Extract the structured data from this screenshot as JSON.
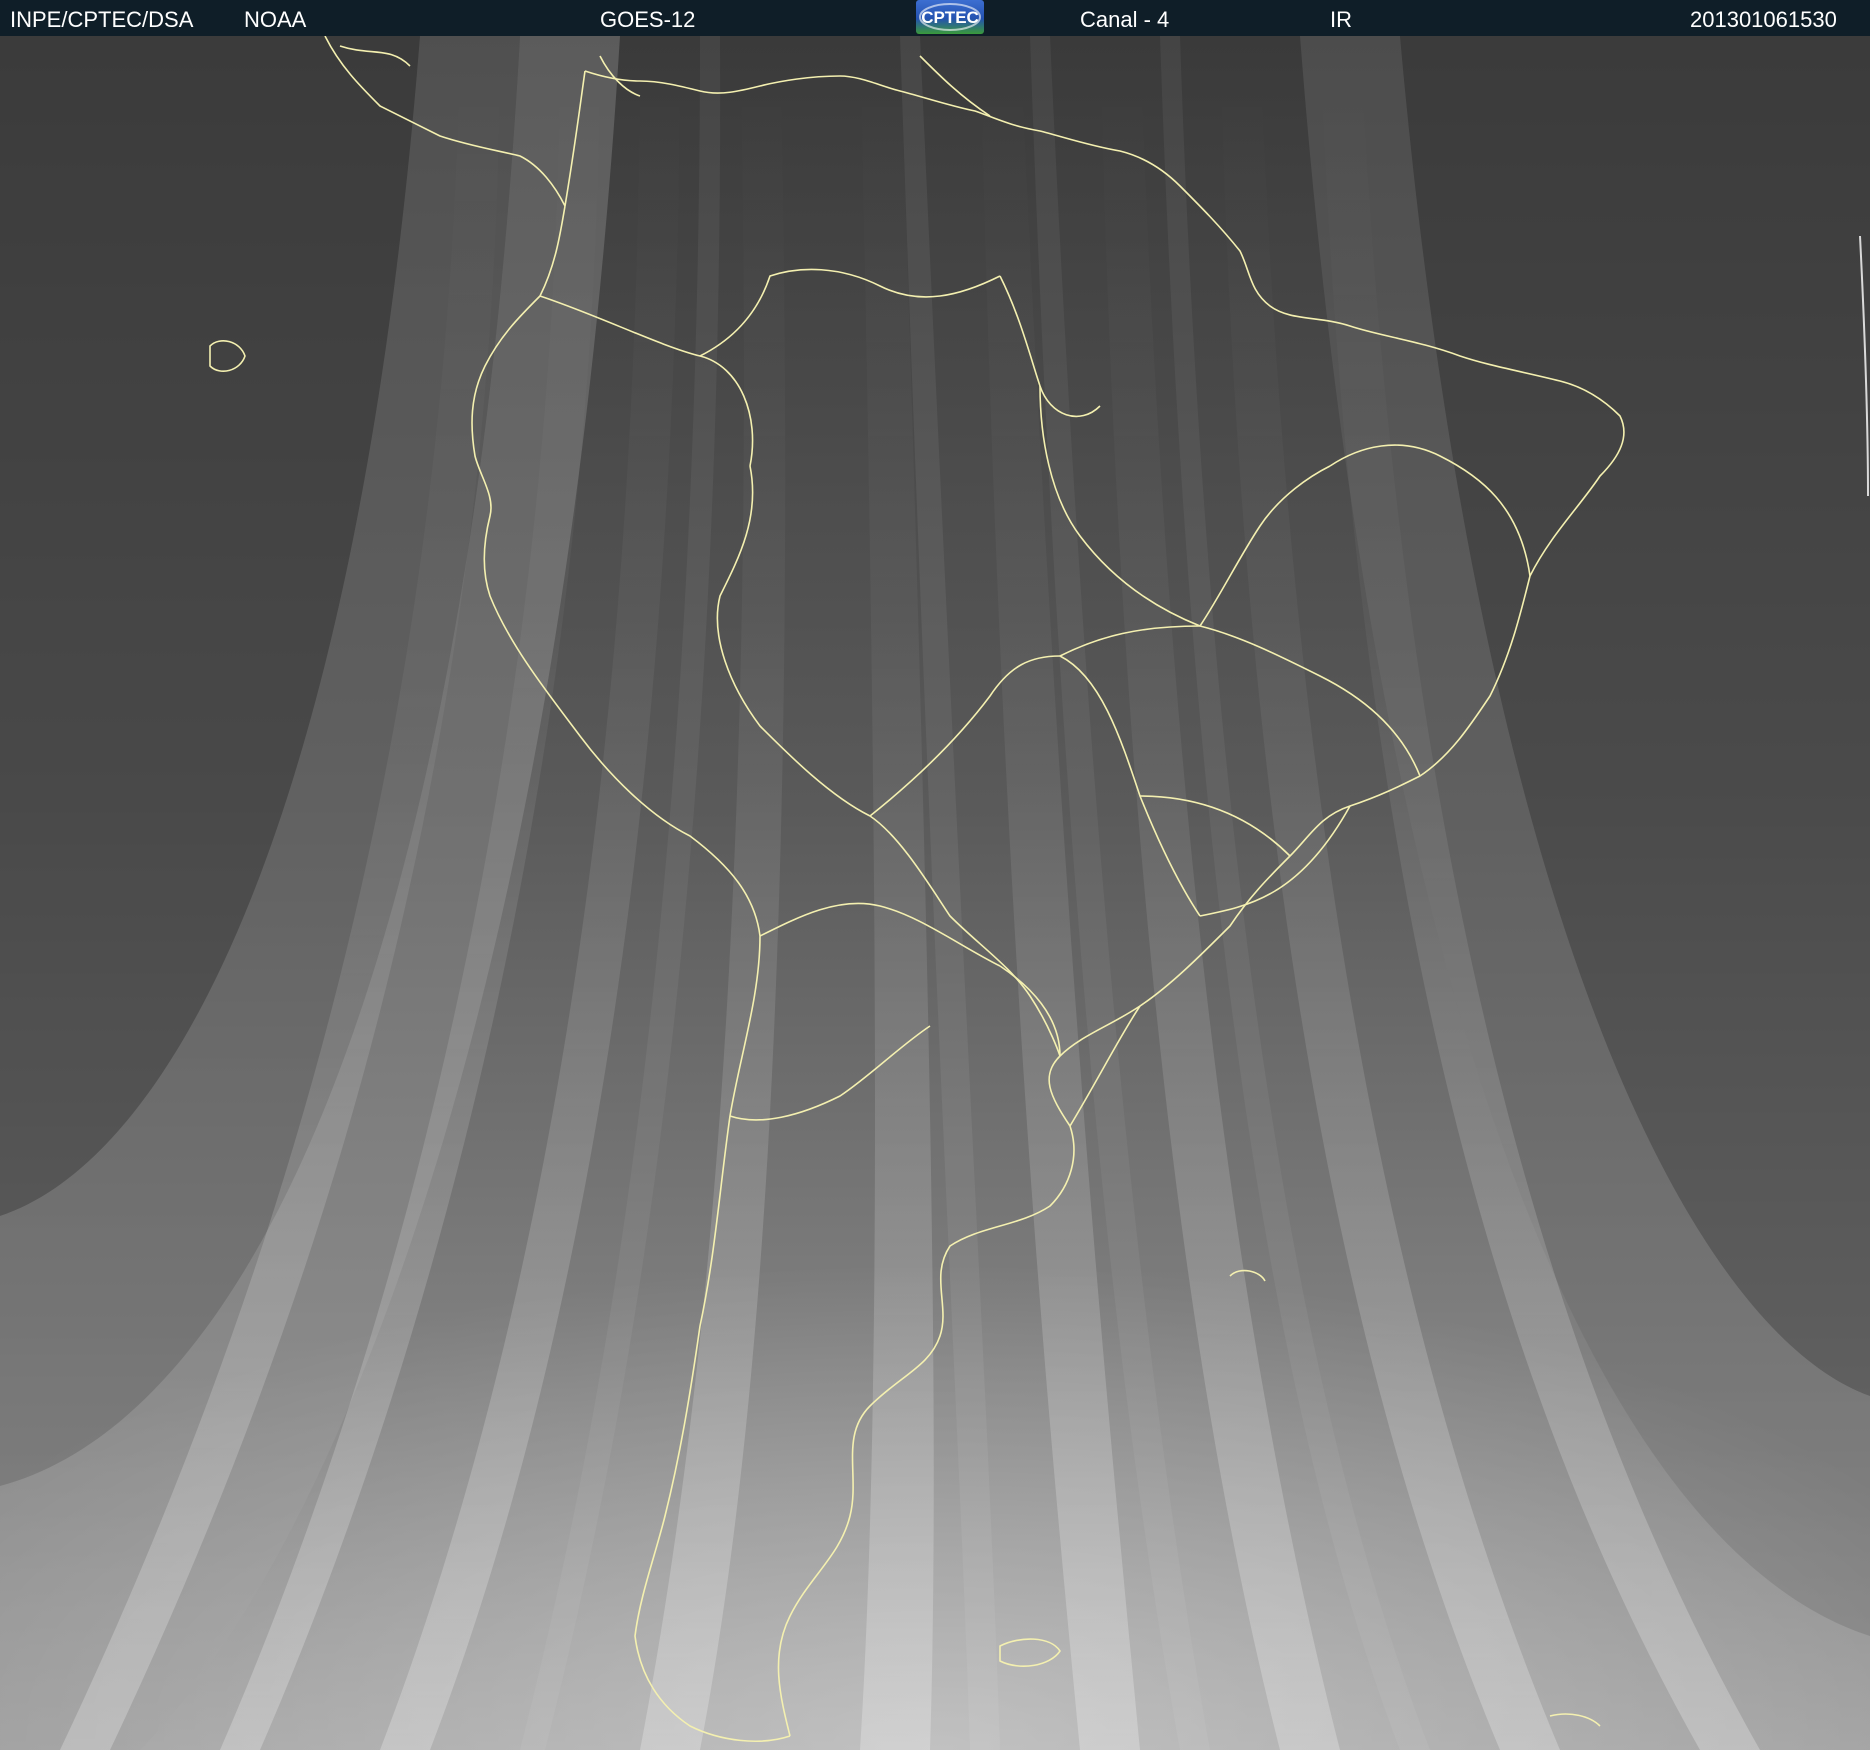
{
  "header": {
    "agency": "INPE/CPTEC/DSA",
    "source": "NOAA",
    "satellite": "GOES-12",
    "logo_text": "CPTEC",
    "channel": "Canal - 4",
    "band": "IR",
    "timestamp": "201301061530"
  },
  "map": {
    "region": "South America",
    "imagery_type": "infrared satellite",
    "coastline_color": "#f4f0b0",
    "background_dark": "#3b3b3b",
    "background_light": "#bdbdbd"
  }
}
